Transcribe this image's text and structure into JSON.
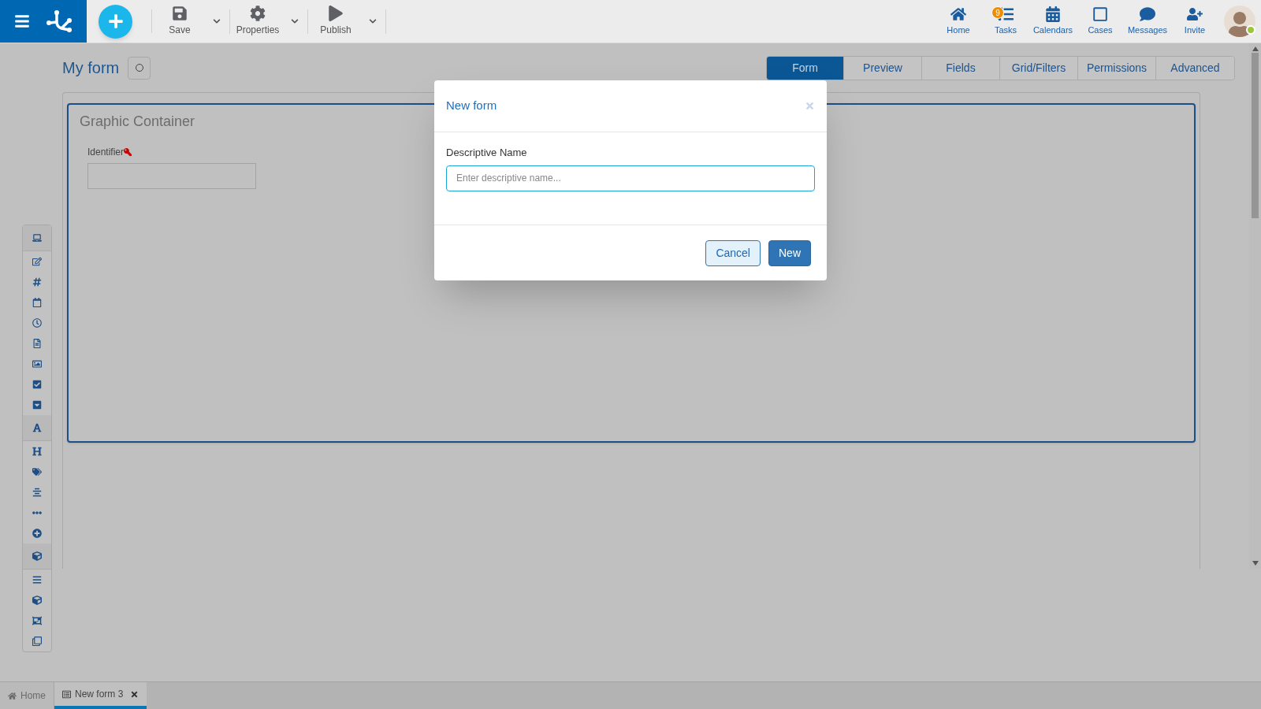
{
  "toolbar": {
    "actions": [
      {
        "label": "Save",
        "kind": "save"
      },
      {
        "label": "Properties",
        "kind": "properties"
      },
      {
        "label": "Publish",
        "kind": "publish"
      }
    ],
    "nav": [
      {
        "label": "Home",
        "kind": "home"
      },
      {
        "label": "Tasks",
        "kind": "tasks",
        "badge": "9"
      },
      {
        "label": "Calendars",
        "kind": "calendars"
      },
      {
        "label": "Cases",
        "kind": "cases"
      },
      {
        "label": "Messages",
        "kind": "messages"
      },
      {
        "label": "Invite",
        "kind": "invite"
      }
    ]
  },
  "user": {
    "online": true
  },
  "page": {
    "title": "My form",
    "tabs": [
      {
        "label": "Form",
        "selected": true
      },
      {
        "label": "Preview",
        "selected": false
      },
      {
        "label": "Fields",
        "selected": false
      },
      {
        "label": "Grid/Filters",
        "selected": false
      },
      {
        "label": "Permissions",
        "selected": false
      },
      {
        "label": "Advanced",
        "selected": false
      }
    ]
  },
  "container": {
    "title": "Graphic Container",
    "field_label": "Identifier"
  },
  "dialog": {
    "title": "New form",
    "field_label": "Descriptive Name",
    "placeholder": "Enter descriptive name...",
    "buttons": [
      {
        "label": "Cancel",
        "kind": "secondary"
      },
      {
        "label": "New",
        "kind": "primary"
      }
    ]
  },
  "bottom_tabs": [
    {
      "label": "Home",
      "kind": "home",
      "selected": false,
      "closable": false
    },
    {
      "label": "New form 3",
      "kind": "form",
      "selected": true,
      "closable": true
    }
  ]
}
